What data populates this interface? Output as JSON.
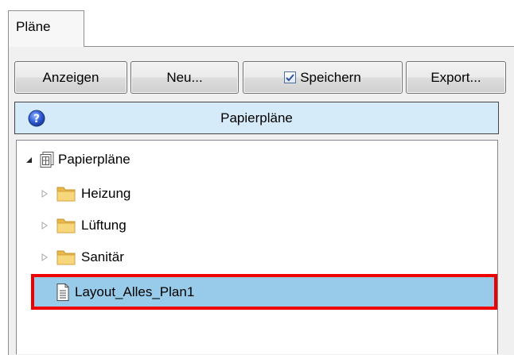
{
  "tabs": [
    {
      "label": "Pläne"
    }
  ],
  "toolbar": {
    "anzeigen_label": "Anzeigen",
    "neu_label": "Neu...",
    "speichern_label": "Speichern",
    "speichern_checked": true,
    "export_label": "Export..."
  },
  "header": {
    "title": "Papierpläne",
    "icon": "help-icon"
  },
  "tree": {
    "root": {
      "label": "Papierpläne",
      "expanded": true,
      "icon": "paper-plan-icon"
    },
    "items": [
      {
        "label": "Heizung",
        "icon": "folder-icon",
        "expanded": false
      },
      {
        "label": "Lüftung",
        "icon": "folder-icon",
        "expanded": false
      },
      {
        "label": "Sanitär",
        "icon": "folder-icon",
        "expanded": false
      },
      {
        "label": "Layout_Alles_Plan1",
        "icon": "document-icon",
        "selected": true
      }
    ]
  },
  "colors": {
    "selection": "#97cbe9",
    "highlight_border": "#ee0000",
    "header_bg": "#d5ebf9"
  }
}
